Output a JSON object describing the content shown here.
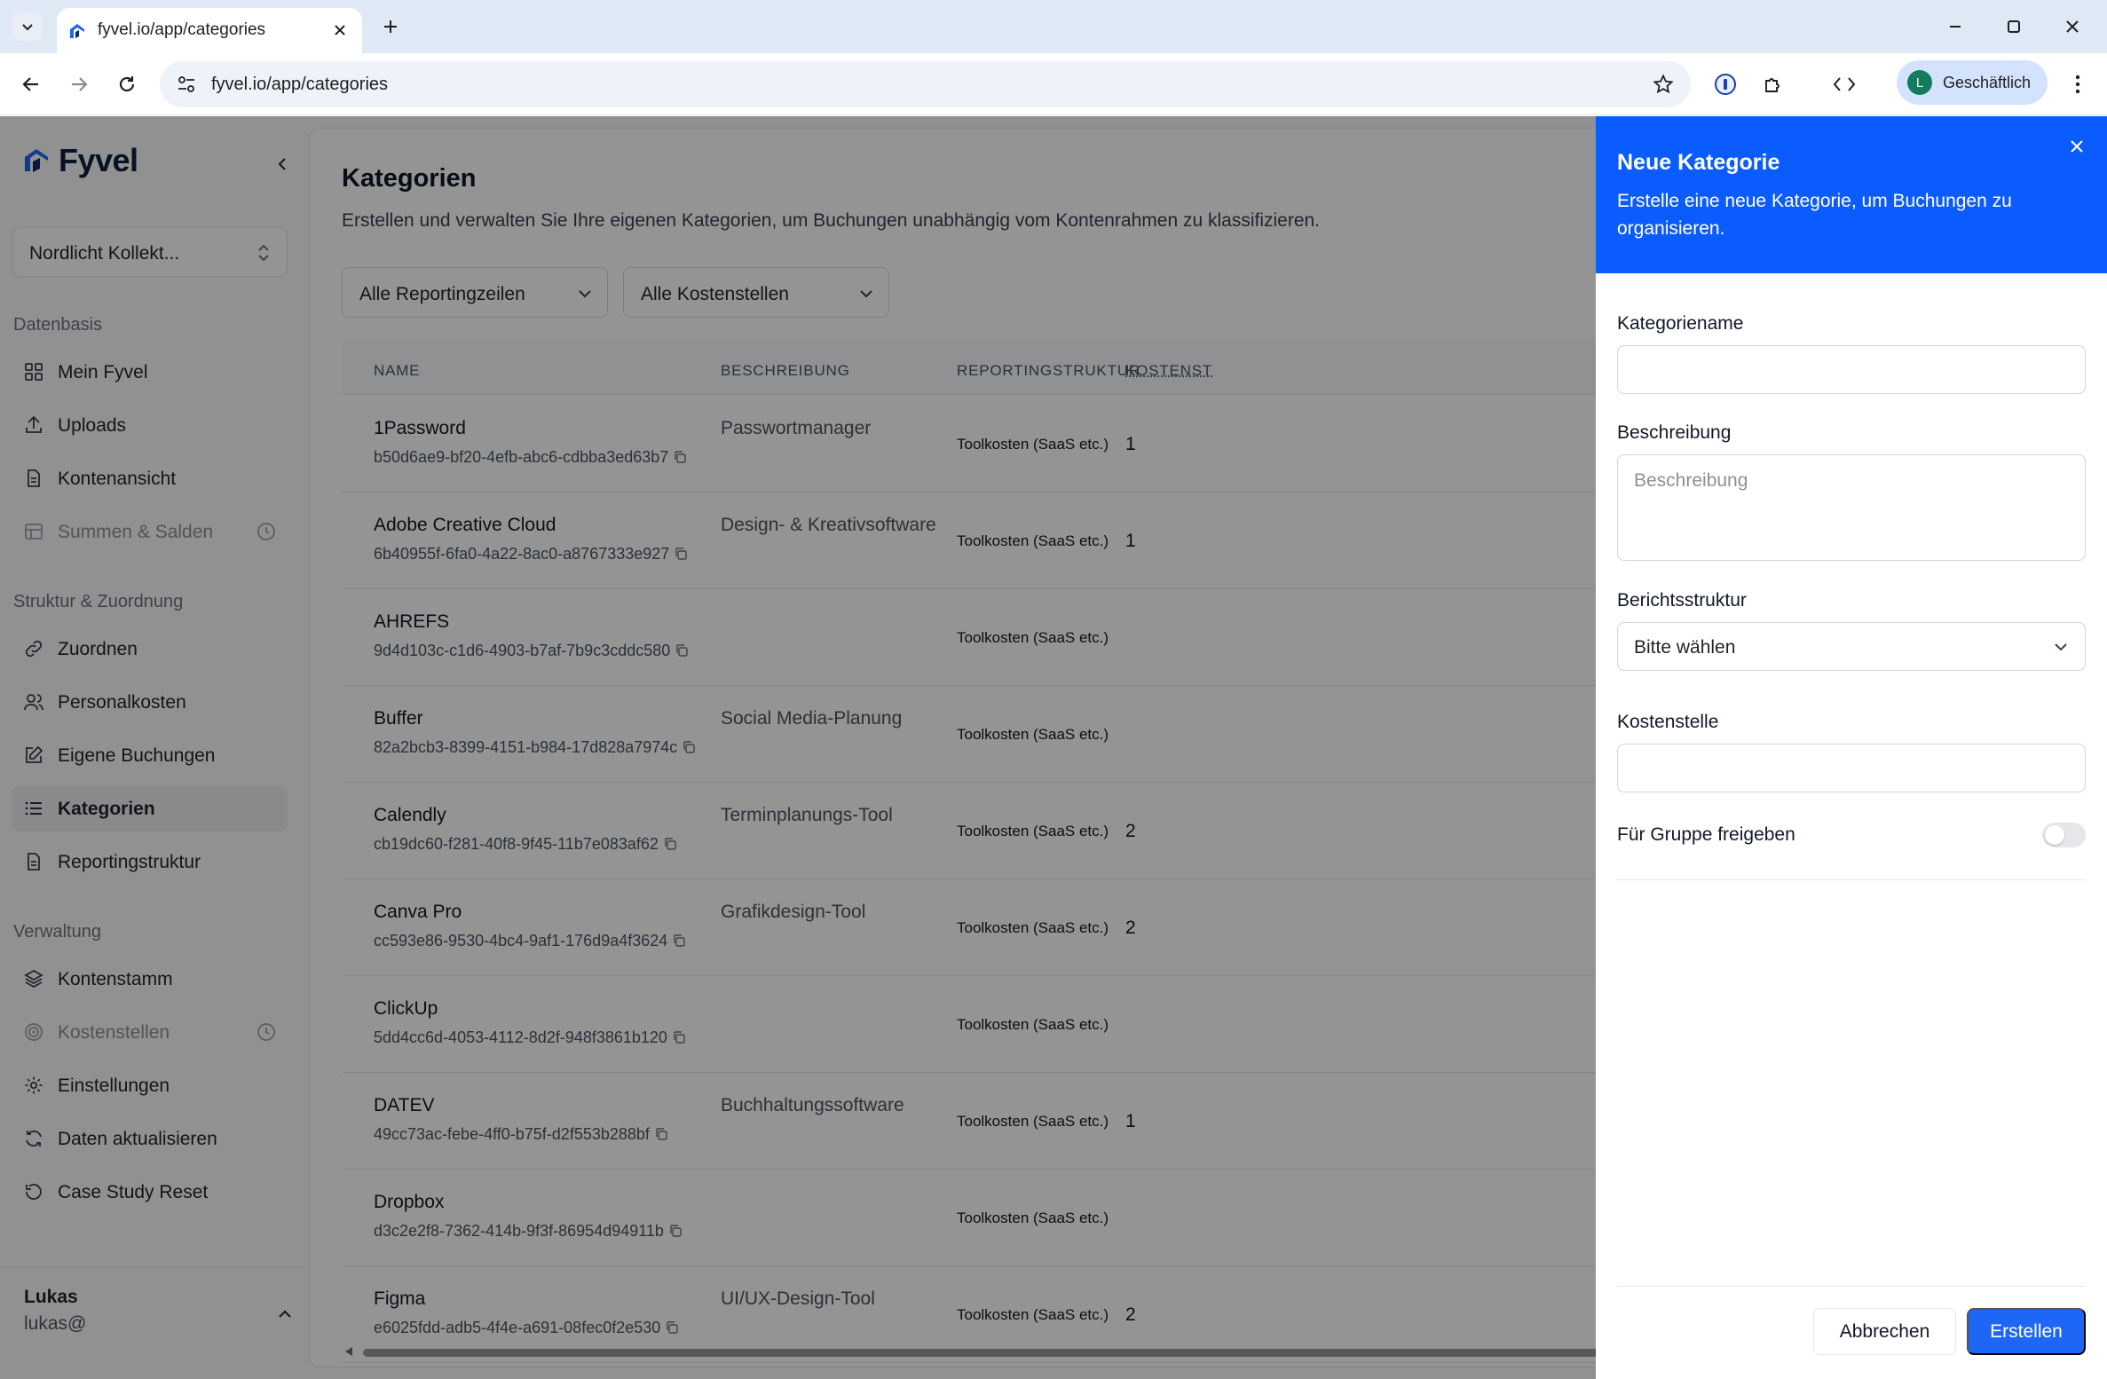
{
  "browser": {
    "tab_title": "fyvel.io/app/categories",
    "url": "fyvel.io/app/categories",
    "profile_initial": "L",
    "profile_label": "Geschäftlich"
  },
  "app": {
    "logo_text": "Fyvel",
    "org_name": "Nordlicht Kollekt...",
    "sections": {
      "datenbasis": "Datenbasis",
      "struktur": "Struktur & Zuordnung",
      "verwaltung": "Verwaltung"
    },
    "nav": {
      "mein_fyvel": "Mein Fyvel",
      "uploads": "Uploads",
      "kontenansicht": "Kontenansicht",
      "summen": "Summen & Salden",
      "zuordnen": "Zuordnen",
      "personalkosten": "Personalkosten",
      "eigene_buchungen": "Eigene Buchungen",
      "kategorien": "Kategorien",
      "reportingstruktur": "Reportingstruktur",
      "kontenstamm": "Kontenstamm",
      "kostenstellen": "Kostenstellen",
      "einstellungen": "Einstellungen",
      "daten_aktualisieren": "Daten aktualisieren",
      "case_study_reset": "Case Study Reset"
    },
    "user": {
      "name": "Lukas",
      "email": "lukas@"
    }
  },
  "page": {
    "title": "Kategorien",
    "description": "Erstellen und verwalten Sie Ihre eigenen Kategorien, um Buchungen unabhängig vom Kontenrahmen zu klassifizieren.",
    "filter_reporting": "Alle Reportingzeilen",
    "filter_kostenstellen": "Alle Kostenstellen",
    "columns": [
      "NAME",
      "BESCHREIBUNG",
      "REPORTINGSTRUKTUR",
      "KOSTENST"
    ],
    "rows": [
      {
        "name": "1Password",
        "id": "b50d6ae9-bf20-4efb-abc6-cdbba3ed63b7",
        "desc": "Passwortmanager",
        "rep": "Toolkosten (SaaS etc.)",
        "kst": "1"
      },
      {
        "name": "Adobe Creative Cloud",
        "id": "6b40955f-6fa0-4a22-8ac0-a8767333e927",
        "desc": "Design- & Kreativsoftware",
        "rep": "Toolkosten (SaaS etc.)",
        "kst": "1"
      },
      {
        "name": "AHREFS",
        "id": "9d4d103c-c1d6-4903-b7af-7b9c3cddc580",
        "desc": "",
        "rep": "Toolkosten (SaaS etc.)",
        "kst": ""
      },
      {
        "name": "Buffer",
        "id": "82a2bcb3-8399-4151-b984-17d828a7974c",
        "desc": "Social Media-Planung",
        "rep": "Toolkosten (SaaS etc.)",
        "kst": ""
      },
      {
        "name": "Calendly",
        "id": "cb19dc60-f281-40f8-9f45-11b7e083af62",
        "desc": "Terminplanungs-Tool",
        "rep": "Toolkosten (SaaS etc.)",
        "kst": "2"
      },
      {
        "name": "Canva Pro",
        "id": "cc593e86-9530-4bc4-9af1-176d9a4f3624",
        "desc": "Grafikdesign-Tool",
        "rep": "Toolkosten (SaaS etc.)",
        "kst": "2"
      },
      {
        "name": "ClickUp",
        "id": "5dd4cc6d-4053-4112-8d2f-948f3861b120",
        "desc": "",
        "rep": "Toolkosten (SaaS etc.)",
        "kst": ""
      },
      {
        "name": "DATEV",
        "id": "49cc73ac-febe-4ff0-b75f-d2f553b288bf",
        "desc": "Buchhaltungssoftware",
        "rep": "Toolkosten (SaaS etc.)",
        "kst": "1"
      },
      {
        "name": "Dropbox",
        "id": "d3c2e2f8-7362-414b-9f3f-86954d94911b",
        "desc": "",
        "rep": "Toolkosten (SaaS etc.)",
        "kst": ""
      },
      {
        "name": "Figma",
        "id": "e6025fdd-adb5-4f4e-a691-08fec0f2e530",
        "desc": "UI/UX-Design-Tool",
        "rep": "Toolkosten (SaaS etc.)",
        "kst": "2"
      }
    ]
  },
  "drawer": {
    "title": "Neue Kategorie",
    "subtitle": "Erstelle eine neue Kategorie, um Buchungen zu organisieren.",
    "name_label": "Kategoriename",
    "name_value": "",
    "desc_label": "Beschreibung",
    "desc_placeholder": "Beschreibung",
    "struktur_label": "Berichtsstruktur",
    "struktur_value": "Bitte wählen",
    "kostenstelle_label": "Kostenstelle",
    "kostenstelle_value": "",
    "share_label": "Für Gruppe freigeben",
    "share_enabled": false,
    "cancel_label": "Abbrechen",
    "create_label": "Erstellen"
  },
  "colors": {
    "accent": "#0b5cff",
    "primary_button": "#1e66f5",
    "profile_avatar": "#137c5c"
  }
}
